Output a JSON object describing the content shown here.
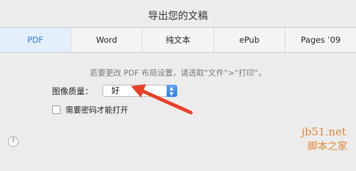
{
  "dialog": {
    "title": "导出您的文稿",
    "tabs": [
      {
        "label": "PDF",
        "active": true
      },
      {
        "label": "Word",
        "active": false
      },
      {
        "label": "纯文本",
        "active": false
      },
      {
        "label": "ePub",
        "active": false
      },
      {
        "label": "Pages ’09",
        "active": false
      }
    ],
    "hint": "若要更改 PDF 布局设置，请选取“文件”>“打印”。",
    "image_quality": {
      "label": "图像质量：",
      "value": "好"
    },
    "password": {
      "label": "需要密码才能打开",
      "checked": false
    },
    "help_label": "?"
  },
  "watermark": {
    "url": "jb51.net",
    "text": "脚本之家"
  },
  "colors": {
    "accent": "#2f7fd8",
    "arrow": "#e8402a",
    "watermark": "#e08a37"
  }
}
